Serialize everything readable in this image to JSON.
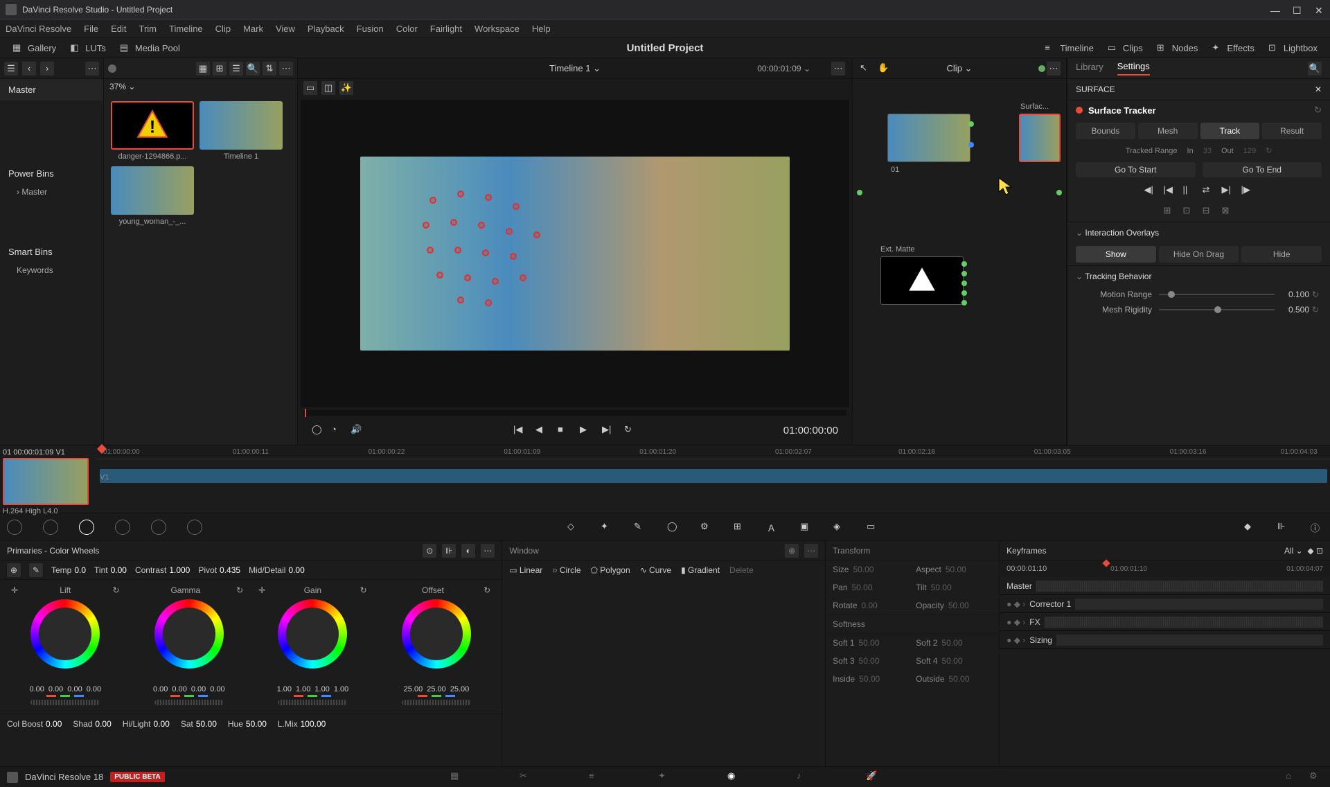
{
  "titlebar": {
    "title": "DaVinci Resolve Studio - Untitled Project"
  },
  "menu": [
    "DaVinci Resolve",
    "File",
    "Edit",
    "Trim",
    "Timeline",
    "Clip",
    "Mark",
    "View",
    "Playback",
    "Fusion",
    "Color",
    "Fairlight",
    "Workspace",
    "Help"
  ],
  "toolbar": {
    "gallery": "Gallery",
    "luts": "LUTs",
    "mediapool": "Media Pool",
    "timeline": "Timeline",
    "clips": "Clips",
    "nodes": "Nodes",
    "effects": "Effects",
    "lightbox": "Lightbox",
    "project": "Untitled Project"
  },
  "browser": {
    "master": "Master",
    "powerbins": "Power Bins",
    "powerbins_items": [
      "Master"
    ],
    "smartbins": "Smart Bins",
    "smartbins_items": [
      "Keywords"
    ]
  },
  "thumbs": {
    "zoom": "37%",
    "items": [
      {
        "label": "danger-1294866.p..."
      },
      {
        "label": "Timeline 1"
      },
      {
        "label": "young_woman_-_..."
      }
    ]
  },
  "viewer": {
    "timeline_name": "Timeline 1",
    "tc": "00:00:01:09",
    "tc_play": "01:00:00:00"
  },
  "nodes": {
    "clip": "Clip",
    "node1": "01",
    "matte": "Ext. Matte",
    "surf_tab": "Surfac..."
  },
  "surface": {
    "library": "Library",
    "settings": "Settings",
    "header": "SURFACE",
    "tracker": "Surface Tracker",
    "tabs": {
      "bounds": "Bounds",
      "mesh": "Mesh",
      "track": "Track",
      "result": "Result"
    },
    "range_lbl": "Tracked Range",
    "in": "In",
    "in_v": "33",
    "out": "Out",
    "out_v": "129",
    "gostart": "Go To Start",
    "goend": "Go To End",
    "overlays": "Interaction Overlays",
    "overlay_btns": {
      "show": "Show",
      "hideondrag": "Hide On Drag",
      "hide": "Hide"
    },
    "behavior": "Tracking Behavior",
    "motion": "Motion Range",
    "motion_v": "0.100",
    "rigidity": "Mesh Rigidity",
    "rigidity_v": "0.500"
  },
  "miniclip": {
    "head": "01   00:00:01:09    V1",
    "codec": "H.264 High L4.0"
  },
  "ruler_ticks": [
    "01:00:00:00",
    "01:00:00:11",
    "01:00:00:22",
    "01:00:01:09",
    "01:00:01:20",
    "01:00:02:07",
    "01:00:02:18",
    "01:00:03:05",
    "01:00:03:16",
    "01:00:04:03"
  ],
  "v1": "V1",
  "primaries": {
    "title": "Primaries - Color Wheels",
    "adjust": {
      "temp": "Temp",
      "temp_v": "0.0",
      "tint": "Tint",
      "tint_v": "0.00",
      "contrast": "Contrast",
      "contrast_v": "1.000",
      "pivot": "Pivot",
      "pivot_v": "0.435",
      "md": "Mid/Detail",
      "md_v": "0.00"
    },
    "wheels": [
      {
        "name": "Lift",
        "vals": [
          "0.00",
          "0.00",
          "0.00",
          "0.00"
        ]
      },
      {
        "name": "Gamma",
        "vals": [
          "0.00",
          "0.00",
          "0.00",
          "0.00"
        ]
      },
      {
        "name": "Gain",
        "vals": [
          "1.00",
          "1.00",
          "1.00",
          "1.00"
        ]
      },
      {
        "name": "Offset",
        "vals": [
          "25.00",
          "25.00",
          "25.00"
        ]
      }
    ],
    "bottom": {
      "colboost": "Col Boost",
      "colboost_v": "0.00",
      "shad": "Shad",
      "shad_v": "0.00",
      "hilight": "Hi/Light",
      "hilight_v": "0.00",
      "sat": "Sat",
      "sat_v": "50.00",
      "hue": "Hue",
      "hue_v": "50.00",
      "lmix": "L.Mix",
      "lmix_v": "100.00"
    }
  },
  "window": {
    "title": "Window",
    "shapes": {
      "linear": "Linear",
      "circle": "Circle",
      "polygon": "Polygon",
      "curve": "Curve",
      "gradient": "Gradient",
      "delete": "Delete"
    }
  },
  "transform": {
    "title": "Transform",
    "softness": "Softness",
    "items": {
      "size": "Size",
      "size_v": "50.00",
      "aspect": "Aspect",
      "aspect_v": "50.00",
      "pan": "Pan",
      "pan_v": "50.00",
      "tilt": "Tilt",
      "tilt_v": "50.00",
      "rotate": "Rotate",
      "rotate_v": "0.00",
      "opacity": "Opacity",
      "opacity_v": "50.00",
      "soft1": "Soft 1",
      "soft1_v": "50.00",
      "soft2": "Soft 2",
      "soft2_v": "50.00",
      "soft3": "Soft 3",
      "soft3_v": "50.00",
      "soft4": "Soft 4",
      "soft4_v": "50.00",
      "inside": "Inside",
      "inside_v": "50.00",
      "outside": "Outside",
      "outside_v": "50.00"
    }
  },
  "keyframes": {
    "title": "Keyframes",
    "all": "All",
    "tc": "00:00:01:10",
    "tc_l": "01:00:01:10",
    "tc_r": "01:00:04:07",
    "rows": [
      "Master",
      "Corrector 1",
      "FX",
      "Sizing"
    ]
  },
  "status": {
    "app": "DaVinci Resolve 18",
    "beta": "PUBLIC BETA"
  }
}
